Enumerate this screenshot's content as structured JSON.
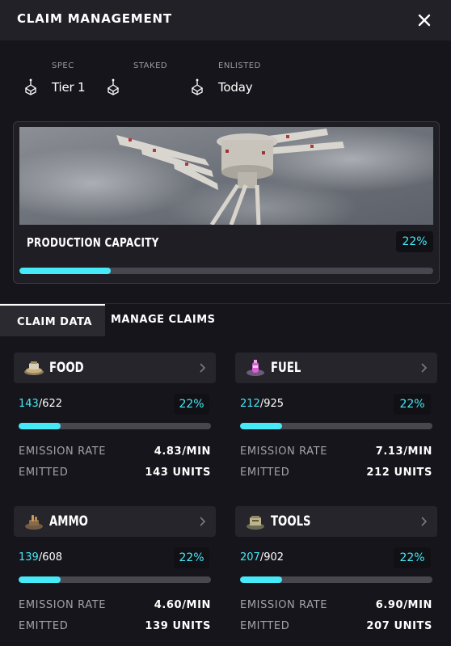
{
  "header": {
    "title": "CLAIM MANAGEMENT"
  },
  "meta": {
    "spec": {
      "label": "SPEC",
      "value": "Tier 1"
    },
    "staked": {
      "label": "STAKED",
      "value": ""
    },
    "enlisted": {
      "label": "ENLISTED",
      "value": "Today"
    }
  },
  "production": {
    "label": "PRODUCTION CAPACITY",
    "percent_text": "22%",
    "percent": 22
  },
  "tabs": [
    {
      "label": "CLAIM DATA",
      "active": true
    },
    {
      "label": "MANAGE CLAIMS",
      "active": false
    }
  ],
  "accent_color": "#45e9f7",
  "resources": [
    {
      "name": "FOOD",
      "icon": "food-icon",
      "current": "143",
      "total": "/622",
      "percent_text": "22%",
      "percent": 22,
      "emission_label": "EMISSION RATE",
      "emission_value": "4.83/MIN",
      "emitted_label": "EMITTED",
      "emitted_value": "143 UNITS"
    },
    {
      "name": "FUEL",
      "icon": "fuel-icon",
      "current": "212",
      "total": "/925",
      "percent_text": "22%",
      "percent": 22,
      "emission_label": "EMISSION RATE",
      "emission_value": "7.13/MIN",
      "emitted_label": "EMITTED",
      "emitted_value": "212 UNITS"
    },
    {
      "name": "AMMO",
      "icon": "ammo-icon",
      "current": "139",
      "total": "/608",
      "percent_text": "22%",
      "percent": 22,
      "emission_label": "EMISSION RATE",
      "emission_value": "4.60/MIN",
      "emitted_label": "EMITTED",
      "emitted_value": "139 UNITS"
    },
    {
      "name": "TOOLS",
      "icon": "tools-icon",
      "current": "207",
      "total": "/902",
      "percent_text": "22%",
      "percent": 22,
      "emission_label": "EMISSION RATE",
      "emission_value": "6.90/MIN",
      "emitted_label": "EMITTED",
      "emitted_value": "207 UNITS"
    }
  ]
}
